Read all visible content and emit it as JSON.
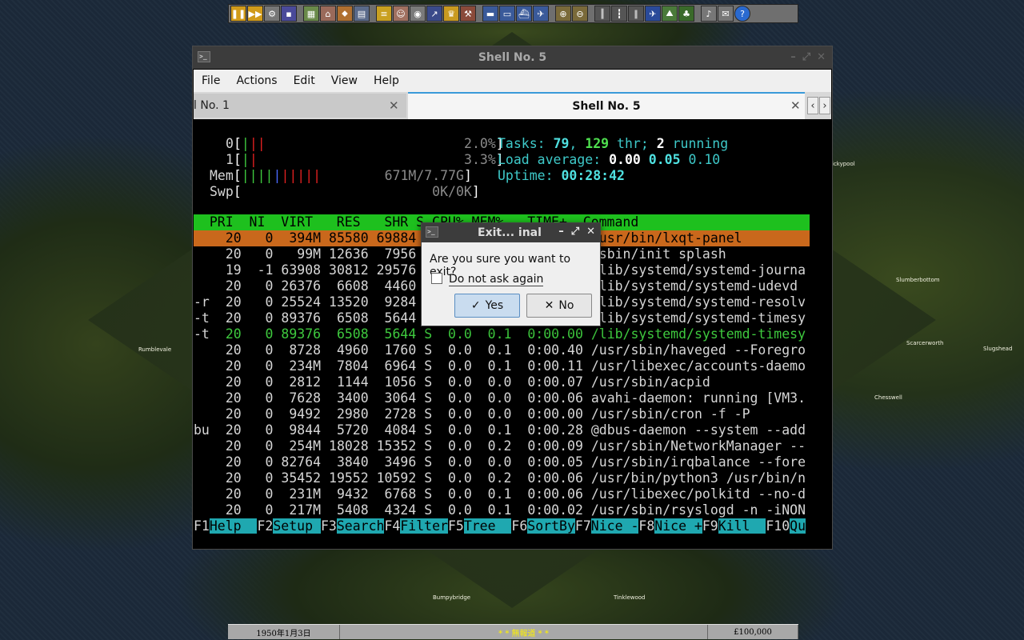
{
  "window": {
    "title": "Shell No. 5"
  },
  "menu": [
    "File",
    "Actions",
    "Edit",
    "View",
    "Help"
  ],
  "tabs": [
    {
      "label": "l No. 1"
    },
    {
      "label": "Shell No. 5"
    }
  ],
  "htop": {
    "cpu0": {
      "id": "0",
      "pct": "2.0%"
    },
    "cpu1": {
      "id": "1",
      "pct": "3.3%"
    },
    "mem": {
      "label": "Mem",
      "val": "671M/7.77G"
    },
    "swp": {
      "label": "Swp",
      "val": "0K/0K"
    },
    "tasks": {
      "label": "Tasks: ",
      "n": "79",
      "sep1": ", ",
      "thr": "129",
      "thr_lbl": " thr; ",
      "run": "2",
      "run_lbl": " running"
    },
    "load": {
      "label": "Load average: ",
      "a": "0.00",
      "b": "0.05",
      "c": "0.10"
    },
    "uptime": {
      "label": "Uptime: ",
      "val": "00:28:42"
    },
    "header": "  PRI  NI  VIRT   RES   SHR S CPU% MEM%   TIME+  Command",
    "rows": [
      "  20   0  394M 85580 69884 S  0.0  1.0  0:00.94 /usr/bin/lxqt-panel",
      "  20   0   99M 12636  7956 S  0.0  0.2  0:02.10 /sbin/init splash",
      "  19  -1 63908 30812 29576 S  0.0  0.4  0:00.32 /lib/systemd/systemd-journa",
      "  20   0 26376  6608  4460 S  0.0  0.1  0:00.17 /lib/systemd/systemd-udevd",
      "  20   0 25524 13520  9284 S  0.0  0.2  0:00.10 /lib/systemd/systemd-resolv",
      "  20   0 89376  6508  5644 S  0.0  0.1  0:00.03 /lib/systemd/systemd-timesy",
      "  20   0 89376  6508  5644 S  0.0  0.1  0:00.00 /lib/systemd/systemd-timesy",
      "  20   0  8728  4960  1760 S  0.0  0.1  0:00.40 /usr/sbin/haveged --Foregro",
      "  20   0  234M  7804  6964 S  0.0  0.1  0:00.11 /usr/libexec/accounts-daemo",
      "  20   0  2812  1144  1056 S  0.0  0.0  0:00.07 /usr/sbin/acpid",
      "  20   0  7628  3400  3064 S  0.0  0.0  0:00.06 avahi-daemon: running [VM3.",
      "  20   0  9492  2980  2728 S  0.0  0.0  0:00.00 /usr/sbin/cron -f -P",
      "  20   0  9844  5720  4084 S  0.0  0.1  0:00.28 @dbus-daemon --system --add",
      "  20   0  254M 18028 15352 S  0.0  0.2  0:00.09 /usr/sbin/NetworkManager --",
      "  20   0 82764  3840  3496 S  0.0  0.0  0:00.05 /usr/sbin/irqbalance --fore",
      "  20   0 35452 19552 10592 S  0.0  0.2  0:00.06 /usr/bin/python3 /usr/bin/n",
      "  20   0  231M  9432  6768 S  0.0  0.1  0:00.06 /usr/libexec/polkitd --no-d",
      "  20   0  217M  5408  4324 S  0.0  0.1  0:00.02 /usr/sbin/rsyslogd -n -iNON"
    ],
    "row_prefix": [
      "",
      "",
      "",
      "",
      "-r",
      "-t",
      "-t",
      "",
      "",
      "",
      "",
      "",
      "bu",
      "",
      "",
      "",
      "",
      ""
    ],
    "fkeys": [
      {
        "k": "F1",
        "l": "Help  "
      },
      {
        "k": "F2",
        "l": "Setup "
      },
      {
        "k": "F3",
        "l": "Search"
      },
      {
        "k": "F4",
        "l": "Filter"
      },
      {
        "k": "F5",
        "l": "Tree  "
      },
      {
        "k": "F6",
        "l": "SortBy"
      },
      {
        "k": "F7",
        "l": "Nice -"
      },
      {
        "k": "F8",
        "l": "Nice +"
      },
      {
        "k": "F9",
        "l": "Kill  "
      },
      {
        "k": "F10",
        "l": "Qu"
      }
    ]
  },
  "dialog": {
    "title": "Exit...  inal",
    "message": "Are you sure you want to exit?",
    "checkbox": "Do not ask again",
    "yes": "Yes",
    "no": "No"
  },
  "game": {
    "status_date": "1950年1月3日",
    "status_news": "* * 無報道 * *",
    "status_money": "£100,000",
    "towns": [
      "ickypool",
      "Slumberbottom",
      "Scarcerworth",
      "Slugshead",
      "Chesswell",
      "Rumblevale",
      "Bumpybridge",
      "Tinklewood"
    ]
  },
  "icons": [
    "pause-icon",
    "fast-forward-icon",
    "gear-icon",
    "save-icon",
    "map-icon",
    "town-icon",
    "subsidy-icon",
    "station-icon",
    "finance-icon",
    "company-icon",
    "graph-icon",
    "league-icon",
    "story-icon",
    "industry-icon",
    "train-icon",
    "road-vehicle-icon",
    "ship-icon",
    "aircraft-icon",
    "zoom-in-icon",
    "zoom-out-icon",
    "rail-icon",
    "road-icon",
    "waterway-icon",
    "airport-icon",
    "landscape-icon",
    "tree-icon",
    "music-icon",
    "message-icon",
    "help-icon"
  ]
}
